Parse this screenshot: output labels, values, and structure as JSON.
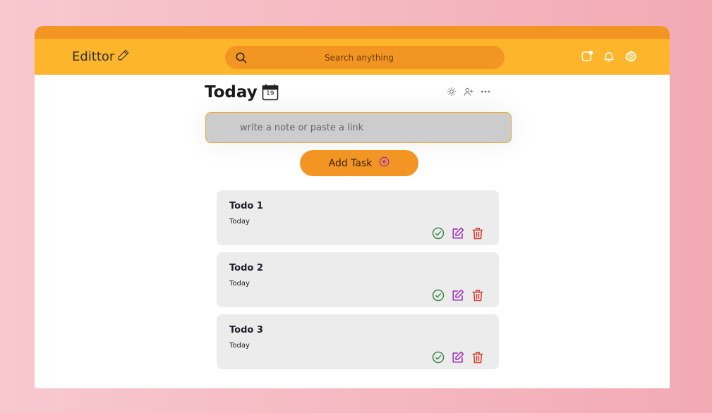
{
  "brand": {
    "name": "Edittor",
    "icon": "pencil-icon"
  },
  "search": {
    "placeholder": "Search anything",
    "icon": "search-icon"
  },
  "header_icons": [
    "notification-dot-icon",
    "bell-icon",
    "gear-icon"
  ],
  "page": {
    "title": "Today",
    "calendar_day": "19"
  },
  "toolbar_icons": [
    "sun-icon",
    "add-user-icon",
    "more-icon"
  ],
  "note_input": {
    "placeholder": "write a note or paste a link",
    "value": ""
  },
  "add_button": {
    "label": "Add Task",
    "icon": "arrow-circle-left-icon"
  },
  "todos": [
    {
      "title": "Todo 1",
      "date": "Today"
    },
    {
      "title": "Todo 2",
      "date": "Today"
    },
    {
      "title": "Todo 3",
      "date": "Today"
    }
  ],
  "colors": {
    "header": "#fdb52b",
    "accent": "#f39523",
    "complete": "#3c8a4c",
    "edit": "#9b2bb8",
    "delete": "#d23a2c"
  }
}
